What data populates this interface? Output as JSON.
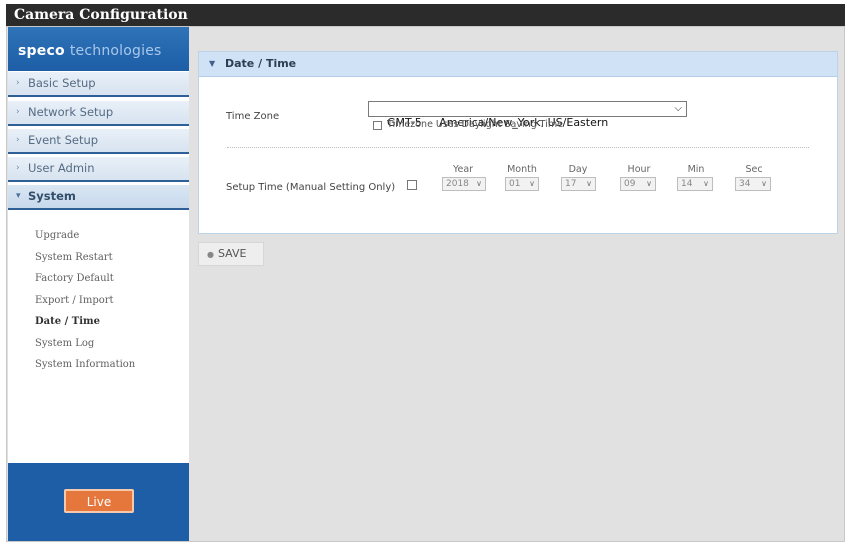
{
  "window": {
    "title": "Camera Configuration"
  },
  "brand": {
    "name_bold": "speco",
    "name_light": "technologies"
  },
  "sidebar": {
    "items": [
      {
        "label": "Basic Setup"
      },
      {
        "label": "Network Setup"
      },
      {
        "label": "Event Setup"
      },
      {
        "label": "User Admin"
      },
      {
        "label": "System"
      }
    ],
    "subitems": [
      {
        "label": "Upgrade"
      },
      {
        "label": "System Restart"
      },
      {
        "label": "Factory Default"
      },
      {
        "label": "Export / Import"
      },
      {
        "label": "Date / Time"
      },
      {
        "label": "System Log"
      },
      {
        "label": "System Information"
      }
    ],
    "live_label": "Live"
  },
  "panel": {
    "title": "Date / Time",
    "time_zone_label": "Time Zone",
    "time_zone_value": "GMT-5     America/New_York, US/Eastern",
    "dst_label": "Timezone Uses Daylight Saving Time",
    "dst_checked": false,
    "setup_time_label": "Setup Time (Manual Setting Only)",
    "setup_time_checked": false,
    "fields": [
      {
        "label": "Year",
        "value": "2018"
      },
      {
        "label": "Month",
        "value": "01"
      },
      {
        "label": "Day",
        "value": "17"
      },
      {
        "label": "Hour",
        "value": "09"
      },
      {
        "label": "Min",
        "value": "14"
      },
      {
        "label": "Sec",
        "value": "34"
      }
    ]
  },
  "actions": {
    "save_label": "SAVE"
  },
  "icons": {
    "nav_arrow": "chevron-right-icon",
    "nav_arrow_active": "chevron-down-icon",
    "panel_caret": "caret-down-icon",
    "select_chevron": "chevron-down-icon",
    "save_icon": "bullet-icon"
  },
  "colors": {
    "title_bar": "#2b2b2b",
    "brand_blue": "#1d5ea6",
    "panel_header": "#cfe2f6",
    "live_button": "#e5773d"
  }
}
